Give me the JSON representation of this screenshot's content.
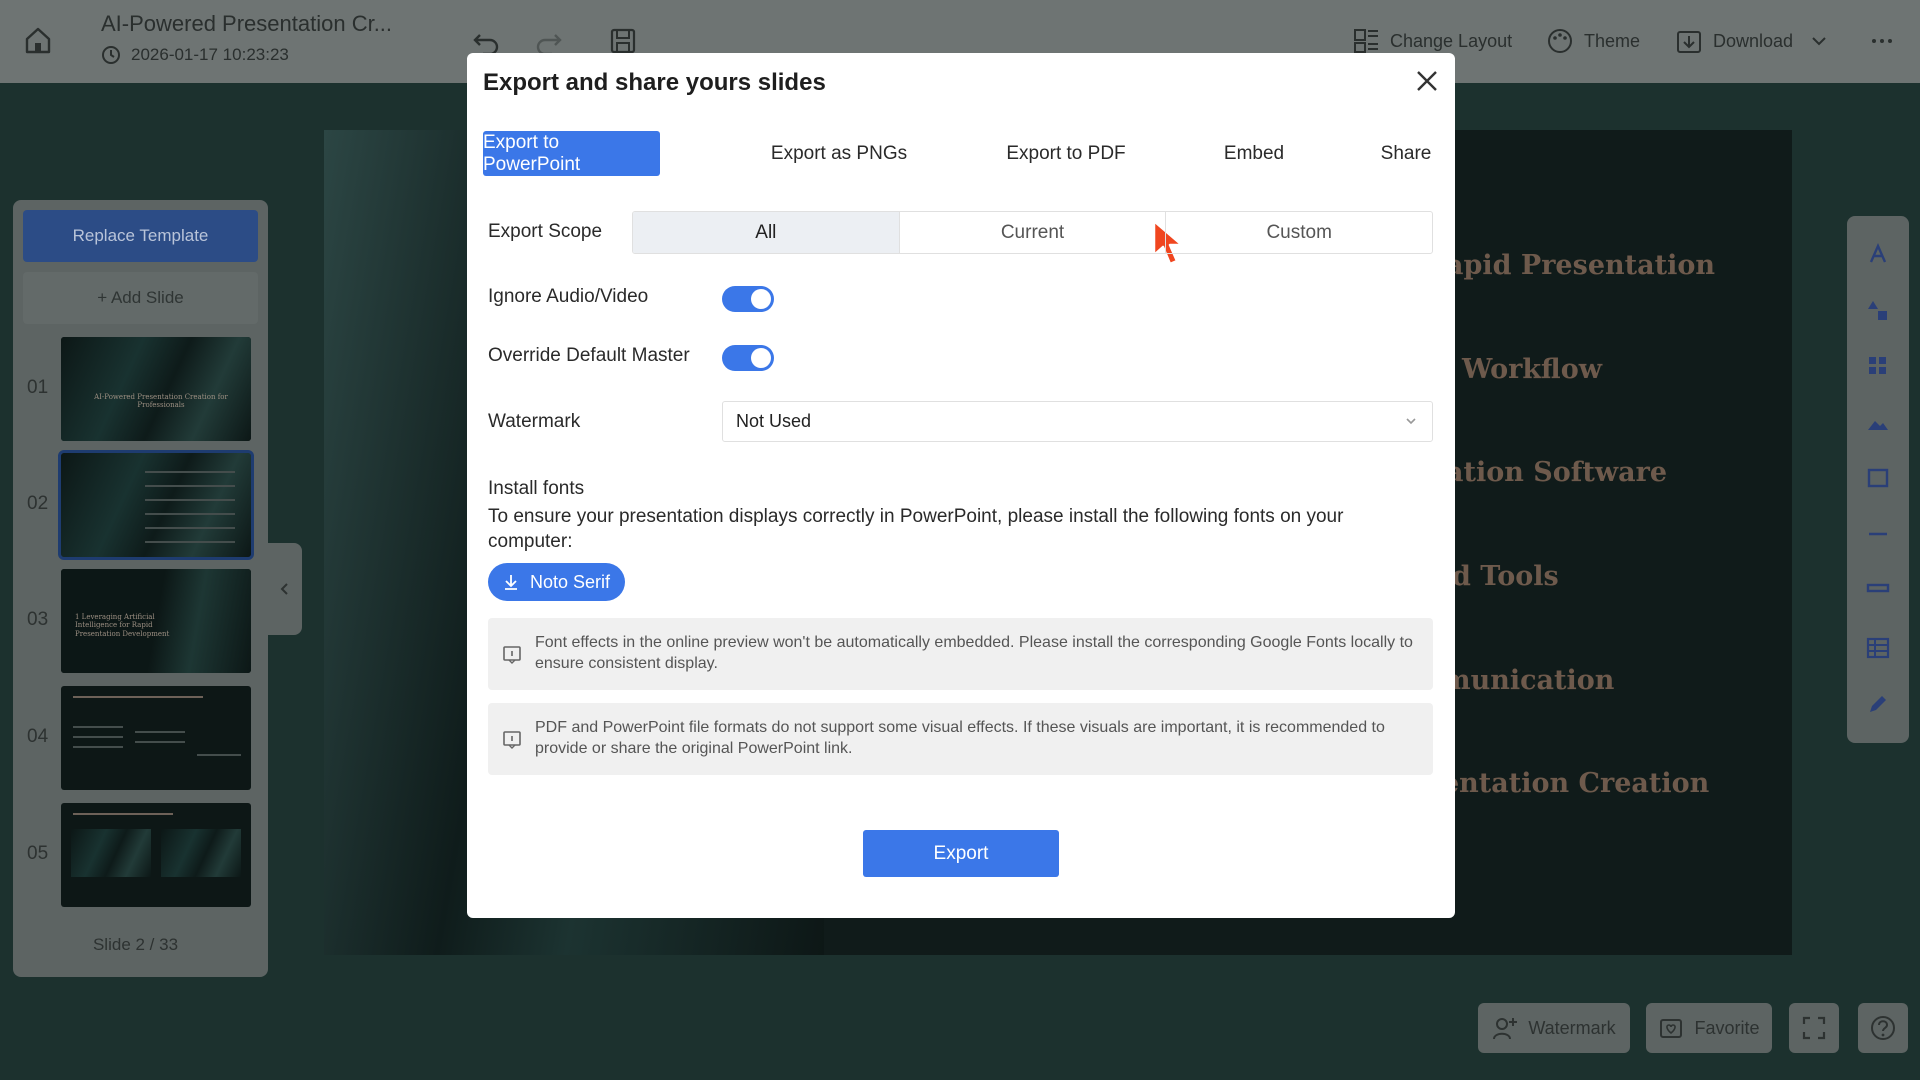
{
  "app": {
    "doc_title": "AI-Powered Presentation Cr...",
    "doc_time": "2026-01-17 10:23:23",
    "change_layout": "Change Layout",
    "theme": "Theme",
    "download": "Download"
  },
  "left_panel": {
    "replace_template": "Replace Template",
    "add_slide": "+ Add Slide",
    "slides": [
      {
        "num": "01",
        "text": "AI-Powered Presentation Creation for Professionals"
      },
      {
        "num": "02",
        "text": ""
      },
      {
        "num": "03",
        "text": "1 Leveraging Artificial Intelligence for Rapid Presentation Development"
      },
      {
        "num": "04",
        "text": ""
      },
      {
        "num": "05",
        "text": ""
      }
    ],
    "slide_count": "Slide 2 / 33"
  },
  "slide_preview": {
    "lines": [
      "apid Presentation",
      "Workflow",
      "ation Software",
      "d Tools",
      "munication",
      "entation Creation"
    ]
  },
  "bottom": {
    "watermark": "Watermark",
    "favorite": "Favorite"
  },
  "modal": {
    "title": "Export and share yours slides",
    "tabs": [
      "Export to PowerPoint",
      "Export as PNGs",
      "Export to PDF",
      "Embed",
      "Share"
    ],
    "export_scope_label": "Export Scope",
    "scope_options": [
      "All",
      "Current",
      "Custom"
    ],
    "ignore_av_label": "Ignore Audio/Video",
    "override_master_label": "Override Default Master",
    "watermark_label": "Watermark",
    "watermark_value": "Not Used",
    "install_fonts_heading": "Install fonts",
    "install_fonts_text": "To ensure your presentation displays correctly in PowerPoint, please install the following fonts on your computer:",
    "font_button": "Noto Serif",
    "notice_1": "Font effects in the online preview won't be automatically embedded. Please install the corresponding Google Fonts locally to ensure consistent display.",
    "notice_2": "PDF and PowerPoint file formats do not support some visual effects. If these visuals are important, it is recommended to provide or share the original PowerPoint link.",
    "export_button": "Export"
  },
  "colors": {
    "accent": "#3b77e8",
    "overlay_topbar": "#6e7473",
    "canvas": "#1c312e"
  }
}
